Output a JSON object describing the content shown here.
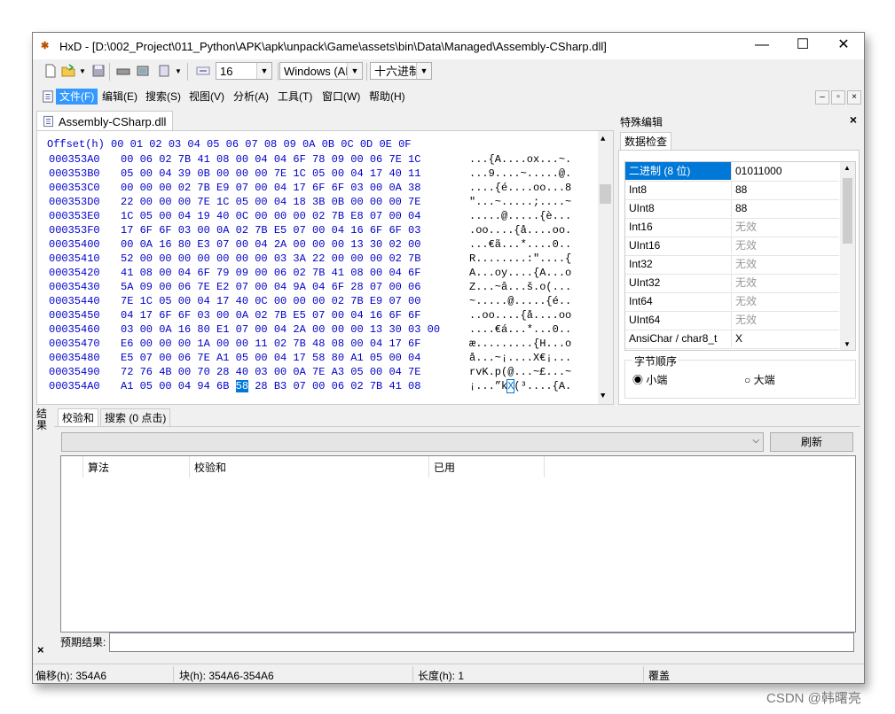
{
  "window": {
    "app_name": "HxD",
    "title": "HxD - [D:\\002_Project\\011_Python\\APK\\apk\\unpack\\Game\\assets\\bin\\Data\\Managed\\Assembly-CSharp.dll]",
    "minimize": "—",
    "maximize": "☐",
    "close": "✕"
  },
  "toolbar": {
    "bytes_per_row": "16",
    "charset": "Windows (ANSI)",
    "offset_base": "十六进制"
  },
  "menu": {
    "items": [
      "文件(F)",
      "编辑(E)",
      "搜索(S)",
      "视图(V)",
      "分析(A)",
      "工具(T)",
      "窗口(W)",
      "帮助(H)"
    ]
  },
  "document_tab": {
    "label": "Assembly-CSharp.dll"
  },
  "hex_view": {
    "header": "Offset(h) 00 01 02 03 04 05 06 07 08 09 0A 0B 0C 0D 0E 0F",
    "rows": [
      {
        "addr": "000353A0",
        "bytes": "00 06 02 7B 41 08 00 04 04 6F 78 09 00 06 7E 1C",
        "ascii": "...{A....ox...~."
      },
      {
        "addr": "000353B0",
        "bytes": "05 00 04 39 0B 00 00 00 7E 1C 05 00 04 17 40 11",
        "ascii": "...9....~.....@."
      },
      {
        "addr": "000353C0",
        "bytes": "00 00 00 02 7B E9 07 00 04 17 6F 6F 03 00 0A 38",
        "ascii": "....{é....oo...8"
      },
      {
        "addr": "000353D0",
        "bytes": "22 00 00 00 7E 1C 05 00 04 18 3B 0B 00 00 00 7E",
        "ascii": "\"...~.....;....~"
      },
      {
        "addr": "000353E0",
        "bytes": "1C 05 00 04 19 40 0C 00 00 00 02 7B E8 07 00 04",
        "ascii": ".....@.....{è..."
      },
      {
        "addr": "000353F0",
        "bytes": "17 6F 6F 03 00 0A 02 7B E5 07 00 04 16 6F 6F 03",
        "ascii": ".oo....{å....oo."
      },
      {
        "addr": "00035400",
        "bytes": "00 0A 16 80 E3 07 00 04 2A 00 00 00 13 30 02 00",
        "ascii": "...€ã...*....0.."
      },
      {
        "addr": "00035410",
        "bytes": "52 00 00 00 00 00 00 00 03 3A 22 00 00 00 02 7B",
        "ascii": "R........:\"....{"
      },
      {
        "addr": "00035420",
        "bytes": "41 08 00 04 6F 79 09 00 06 02 7B 41 08 00 04 6F",
        "ascii": "A...oy....{A...o"
      },
      {
        "addr": "00035430",
        "bytes": "5A 09 00 06 7E E2 07 00 04 9A 04 6F 28 07 00 06",
        "ascii": "Z...~â...š.o(..."
      },
      {
        "addr": "00035440",
        "bytes": "7E 1C 05 00 04 17 40 0C 00 00 00 02 7B E9 07 00",
        "ascii": "~.....@.....{é.."
      },
      {
        "addr": "00035450",
        "bytes": "04 17 6F 6F 03 00 0A 02 7B E5 07 00 04 16 6F 6F",
        "ascii": "..oo....{å....oo"
      },
      {
        "addr": "00035460",
        "bytes": "03 00 0A 16 80 E1 07 00 04 2A 00 00 00 13 30 03 00",
        "ascii": "....€á...*...0.."
      },
      {
        "addr": "00035470",
        "bytes": "E6 00 00 00 1A 00 00 11 02 7B 48 08 00 04 17 6F",
        "ascii": "æ.........{H...o"
      },
      {
        "addr": "00035480",
        "bytes": "E5 07 00 06 7E A1 05 00 04 17 58 80 A1 05 00 04",
        "ascii": "å...~¡....X€¡..."
      },
      {
        "addr": "00035490",
        "bytes": "72 76 4B 00 70 28 40 03 00 0A 7E A3 05 00 04 7E",
        "ascii": "rvK.p(@...~£...~"
      },
      {
        "addr": "000354A0",
        "bytes_pre": "A1 05 00 04 94 6B ",
        "bytes_sel": "58",
        "bytes_post": " 28 B3 07 00 06 02 7B 41 08",
        "ascii_pre": "¡...”k",
        "ascii_sel": "X",
        "ascii_post": "(³....{A."
      }
    ]
  },
  "special_editor": {
    "title": "特殊编辑",
    "close": "×",
    "tab": "数据检查",
    "rows": [
      {
        "name": "二进制 (8 位)",
        "value": "01011000"
      },
      {
        "name": "Int8",
        "value": "88"
      },
      {
        "name": "UInt8",
        "value": "88"
      },
      {
        "name": "Int16",
        "value": "无效"
      },
      {
        "name": "UInt16",
        "value": "无效"
      },
      {
        "name": "Int32",
        "value": "无效"
      },
      {
        "name": "UInt32",
        "value": "无效"
      },
      {
        "name": "Int64",
        "value": "无效"
      },
      {
        "name": "UInt64",
        "value": "无效"
      },
      {
        "name": "AnsiChar / char8_t",
        "value": "X"
      }
    ],
    "byte_order": {
      "label": "字节顺序",
      "little": "小端",
      "big": "大端",
      "selected": "little"
    }
  },
  "results": {
    "side_title": "结果",
    "tabs": [
      "校验和",
      "搜索 (0 点击)"
    ],
    "refresh": "刷新",
    "columns": [
      "算法",
      "校验和",
      "已用"
    ],
    "expected_label": "预期结果:"
  },
  "status": {
    "offset": "偏移(h): 354A6",
    "block": "块(h): 354A6-354A6",
    "length": "长度(h): 1",
    "mode": "覆盖"
  },
  "watermark": "CSDN @韩曙亮"
}
